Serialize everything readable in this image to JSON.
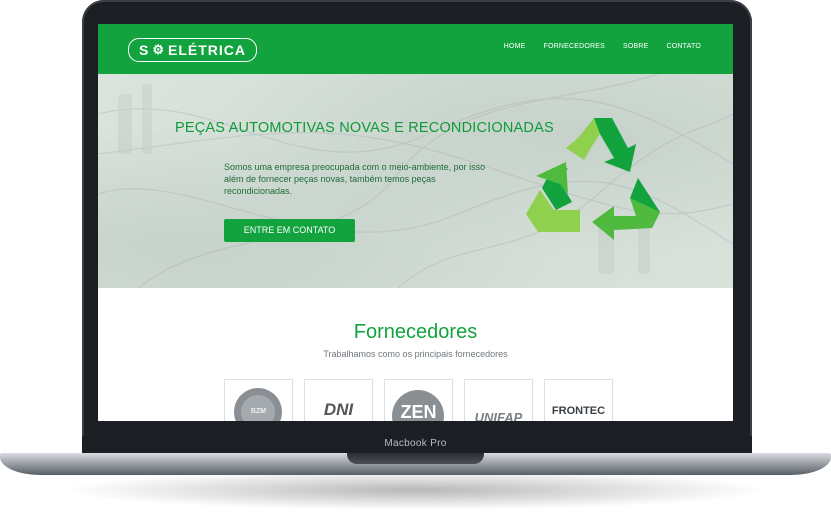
{
  "device": {
    "label": "Macbook Pro"
  },
  "site": {
    "logo": {
      "prefix": "S",
      "suffix": "ELÉTRICA"
    },
    "nav": [
      "HOME",
      "FORNECEDORES",
      "SOBRE",
      "CONTATO"
    ],
    "hero": {
      "title": "PEÇAS AUTOMOTIVAS NOVAS E RECONDICIONADAS",
      "text": "Somos uma empresa preocupada com o meio-ambiente, por isso além de fornecer peças novas, também temos peças recondicionadas.",
      "cta": "ENTRE EM CONTATO"
    },
    "suppliers": {
      "title": "Fornecedores",
      "subtitle": "Trabalhamos como os principais fornecedores",
      "logos": [
        "BZM",
        "DNI",
        "ZEN",
        "UNIFAP",
        "FRONTEC"
      ]
    }
  },
  "colors": {
    "brand_green": "#12a33e",
    "light_green": "#8fd14f"
  }
}
